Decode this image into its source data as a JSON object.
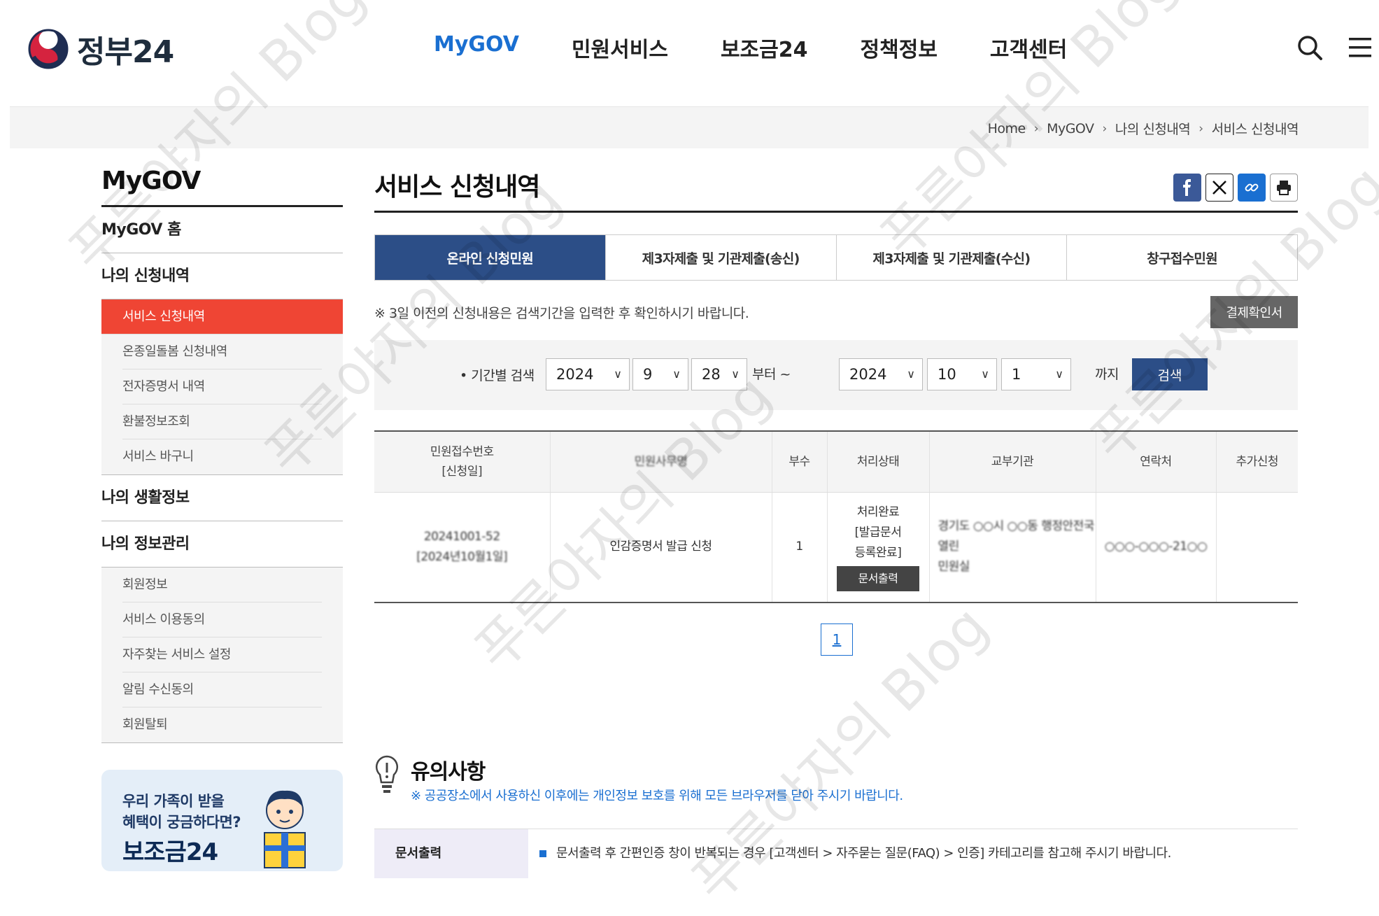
{
  "header": {
    "logo_text": "정부24",
    "nav": [
      "MyGOV",
      "민원서비스",
      "보조금24",
      "정책정보",
      "고객센터"
    ],
    "active_nav": "MyGOV"
  },
  "breadcrumb": [
    "Home",
    "MyGOV",
    "나의 신청내역",
    "서비스 신청내역"
  ],
  "lnb": {
    "title": "MyGOV",
    "home": "MyGOV 홈",
    "section1": "나의 신청내역",
    "section1_items": [
      "서비스 신청내역",
      "온종일돌봄 신청내역",
      "전자증명서 내역",
      "환불정보조회",
      "서비스 바구니"
    ],
    "section2": "나의 생활정보",
    "section3": "나의 정보관리",
    "section3_items": [
      "회원정보",
      "서비스 이용동의",
      "자주찾는 서비스 설정",
      "알림 수신동의",
      "회원탈퇴"
    ]
  },
  "banner": {
    "line1": "우리 가족이 받을",
    "line2": "혜택이 궁금하다면?",
    "title": "보조금24"
  },
  "page": {
    "title": "서비스 신청내역",
    "tabs": [
      "온라인 신청민원",
      "제3자제출 및 기관제출(송신)",
      "제3자제출 및 기관제출(수신)",
      "창구접수민원"
    ],
    "notice": "※ 3일 이전의 신청내용은 검색기간을 입력한 후 확인하시기 바랍니다.",
    "pay_button": "결제확인서"
  },
  "search": {
    "label": "• 기간별 검색",
    "from_year": "2024",
    "from_month": "9",
    "from_day": "28",
    "from_suffix": "부터 ~",
    "to_year": "2024",
    "to_month": "10",
    "to_day": "1",
    "to_suffix": "까지",
    "button": "검색"
  },
  "table": {
    "headers": [
      "민원접수번호",
      "[신청일]",
      "민원사무명",
      "부수",
      "처리상태",
      "교부기관",
      "연락처",
      "추가신청"
    ],
    "row": {
      "receipt_no": "20241001-52",
      "date": "[2024년10월1일]",
      "service": "인감증명서 발급 신청",
      "copies": "1",
      "status_l1": "처리완료",
      "status_l2": "[발급문서",
      "status_l3": "등록완료]",
      "print_button": "문서출력",
      "agency_l1": "경기도 ○○시 ○○동 행정안전국 열린",
      "agency_l2": "민원실",
      "contact": "○○○-○○○-21○○",
      "extra": ""
    }
  },
  "pagination": {
    "current": "1"
  },
  "caution": {
    "title": "유의사항",
    "subtitle": "※ 공공장소에서 사용하신 이후에는 개인정보 보호를 위해 모든 브라우저를 닫아 주시기 바랍니다.",
    "row_head": "문서출력",
    "row_body": "문서출력 후 간편인증 창이 반복되는 경우 [고객센터 > 자주묻는 질문(FAQ) > 인증] 카테고리를 참고해 주시기 바랍니다."
  },
  "watermark": "푸른야자의 Blog",
  "colors": {
    "brand_blue": "#2c4e87",
    "accent_red": "#ef4534",
    "link_blue": "#1a6fd1"
  }
}
